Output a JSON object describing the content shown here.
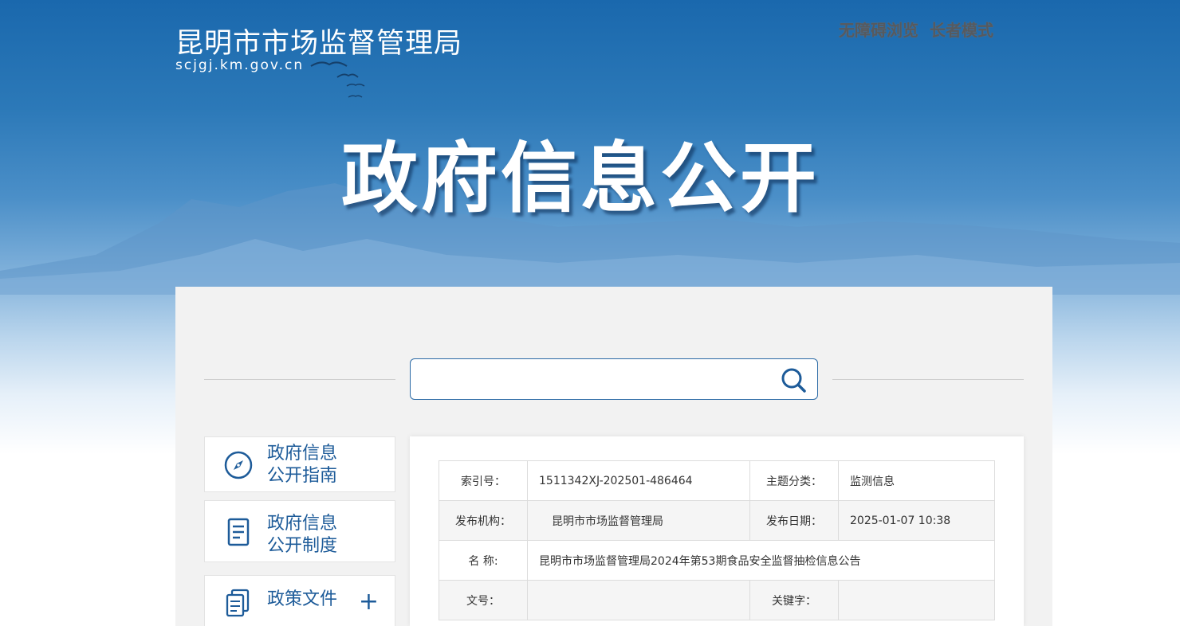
{
  "header": {
    "site_title": "昆明市市场监督管理局",
    "site_domain": "scjgj.km.gov.cn",
    "links": [
      "无障碍浏览",
      "长者模式"
    ],
    "hero_title": "政府信息公开"
  },
  "search": {
    "placeholder": ""
  },
  "sidebar": {
    "items": [
      {
        "label_line1": "政府信息",
        "label_line2": "公开指南",
        "icon": "compass-icon"
      },
      {
        "label_line1": "政府信息",
        "label_line2": "公开制度",
        "icon": "document-icon"
      },
      {
        "label_line1": "政策文件",
        "label_line2": "",
        "icon": "files-icon",
        "expand": "+"
      }
    ]
  },
  "meta": {
    "rows": [
      {
        "k1": "索引号：",
        "v1": "1511342XJ-202501-486464",
        "k2": "主题分类：",
        "v2": "监测信息"
      },
      {
        "k1": "发布机构：",
        "v1": "昆明市市场监督管理局",
        "k2": "发布日期：",
        "v2": "2025-01-07 10:38"
      },
      {
        "k1": "名 称:",
        "v1": "昆明市市场监督管理局2024年第53期食品安全监督抽检信息公告"
      },
      {
        "k1": "文号：",
        "v1": "",
        "k2": "关键字：",
        "v2": ""
      }
    ]
  },
  "colors": {
    "primary": "#1d5b99",
    "banner_top": "#1a68ad",
    "panel_bg": "#f2f2f2"
  }
}
